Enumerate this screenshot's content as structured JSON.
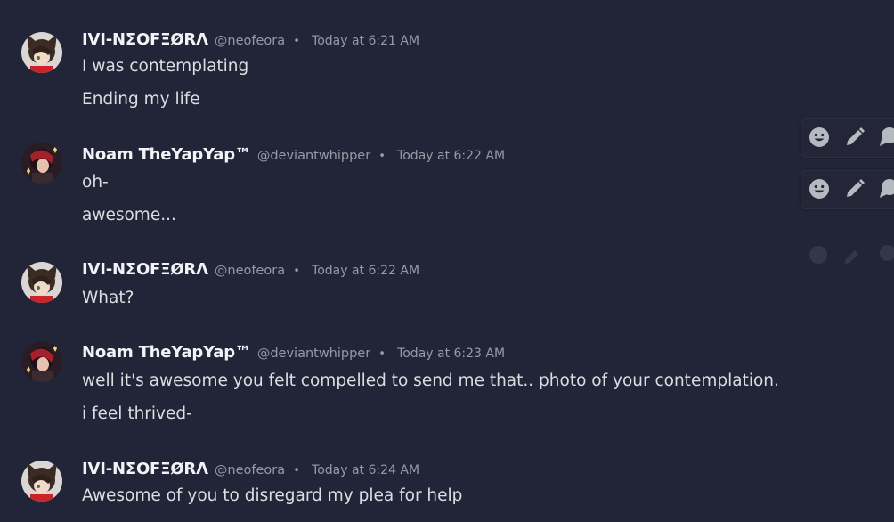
{
  "messages": [
    {
      "username": "IVI-NΣOFΞØRΛ",
      "handle": "@neofeora",
      "separator": "•",
      "time": "Today at 6:21 AM",
      "lines": [
        "I was contemplating",
        "Ending my life"
      ]
    },
    {
      "username": "Noam TheYapYap™",
      "handle": "@deviantwhipper",
      "separator": "•",
      "time": "Today at 6:22 AM",
      "lines": [
        "oh-",
        "awesome..."
      ]
    },
    {
      "username": "IVI-NΣOFΞØRΛ",
      "handle": "@neofeora",
      "separator": "•",
      "time": "Today at 6:22 AM",
      "lines": [
        "What?"
      ]
    },
    {
      "username": "Noam TheYapYap™",
      "handle": "@deviantwhipper",
      "separator": "•",
      "time": "Today at 6:23 AM",
      "lines": [
        "well it's awesome you felt compelled to send me that.. photo of your contemplation.",
        "i feel thrived-"
      ]
    },
    {
      "username": "IVI-NΣOFΞØRΛ",
      "handle": "@neofeora",
      "separator": "•",
      "time": "Today at 6:24 AM",
      "lines": [
        "Awesome of you to disregard my plea for help"
      ]
    }
  ],
  "toolbar_icons": [
    "add-reaction-icon",
    "edit-icon",
    "reply-icon"
  ],
  "colors": {
    "background": "#222538",
    "username": "#f2f3f5",
    "message_text": "#dbdee1",
    "muted": "#949ba4",
    "icon": "#b5bac1"
  }
}
